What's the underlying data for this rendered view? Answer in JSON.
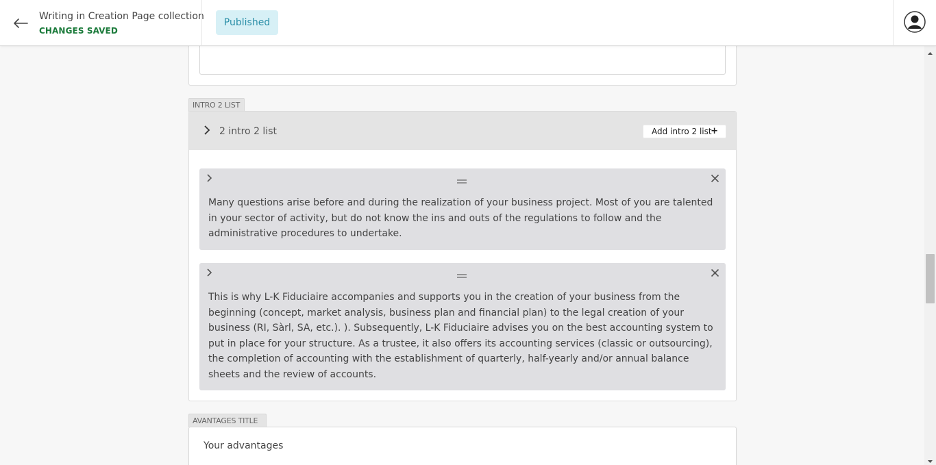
{
  "header": {
    "doc_title": "Writing in Creation Page collection",
    "save_status": "CHANGES SAVED",
    "status_badge": "Published",
    "back_icon": "arrow-left-icon",
    "avatar_icon": "user-avatar-icon"
  },
  "intro2list": {
    "label": "INTRO 2 LIST",
    "count_text": "2 intro 2 list",
    "add_button": "Add intro 2 list",
    "add_button_icon": "+",
    "items": [
      {
        "text": "Many questions arise before and during the realization of your business project. Most of you are talented in your sector of activity, but do not know the ins and outs of the regulations to follow and the administrative procedures to undertake."
      },
      {
        "text": "This is why L-K Fiduciaire accompanies and supports you in the creation of your business from the beginning (concept, market analysis, business plan and financial plan) to the legal creation of your business (RI, Sàrl, SA, etc.). ). Subsequently, L-K Fiduciaire advises you on the best accounting system to put in place for your structure. As a trustee, it also offers its accounting services (classic or outsourcing), the completion of accounting with the establishment of quarterly, half-yearly and/or annual balance sheets and the review of accounts."
      }
    ]
  },
  "advantages": {
    "label": "AVANTAGES TITLE",
    "value": "Your advantages"
  },
  "colors": {
    "save_status": "#1a7a3a",
    "badge_bg": "#d7f0f6",
    "badge_text": "#2b8fa8",
    "item_bg": "#dfdfe2"
  }
}
